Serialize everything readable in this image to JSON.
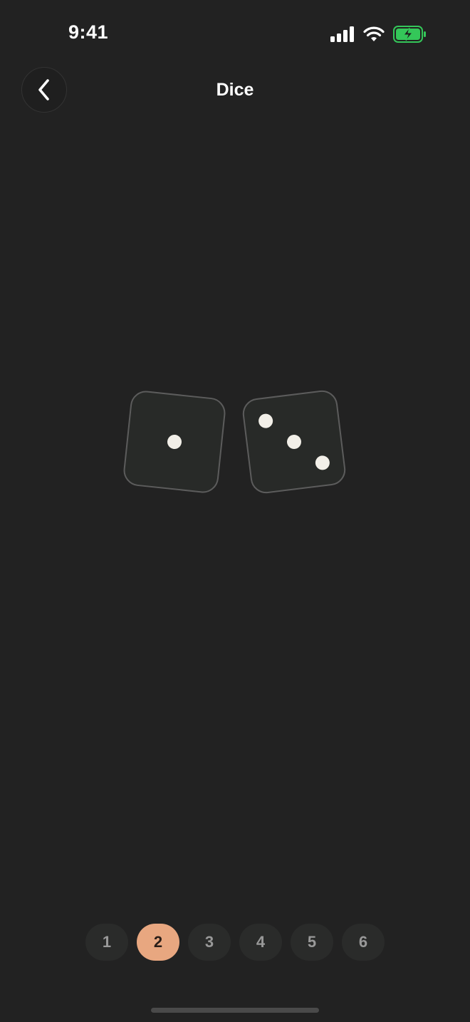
{
  "status_bar": {
    "time": "9:41",
    "icons": [
      "cellular-signal-icon",
      "wifi-icon",
      "battery-charging-icon"
    ],
    "battery_color": "#34c759"
  },
  "nav": {
    "title": "Dice",
    "back_icon": "chevron-left-icon"
  },
  "dice": [
    {
      "value": 1
    },
    {
      "value": 3
    }
  ],
  "dice_count_selector": {
    "options": [
      "1",
      "2",
      "3",
      "4",
      "5",
      "6"
    ],
    "selected": "2"
  },
  "colors": {
    "background": "#222222",
    "die_face": "#282a28",
    "die_border": "#5c5c5c",
    "pip": "#f2efe8",
    "accent": "#e8a780"
  }
}
